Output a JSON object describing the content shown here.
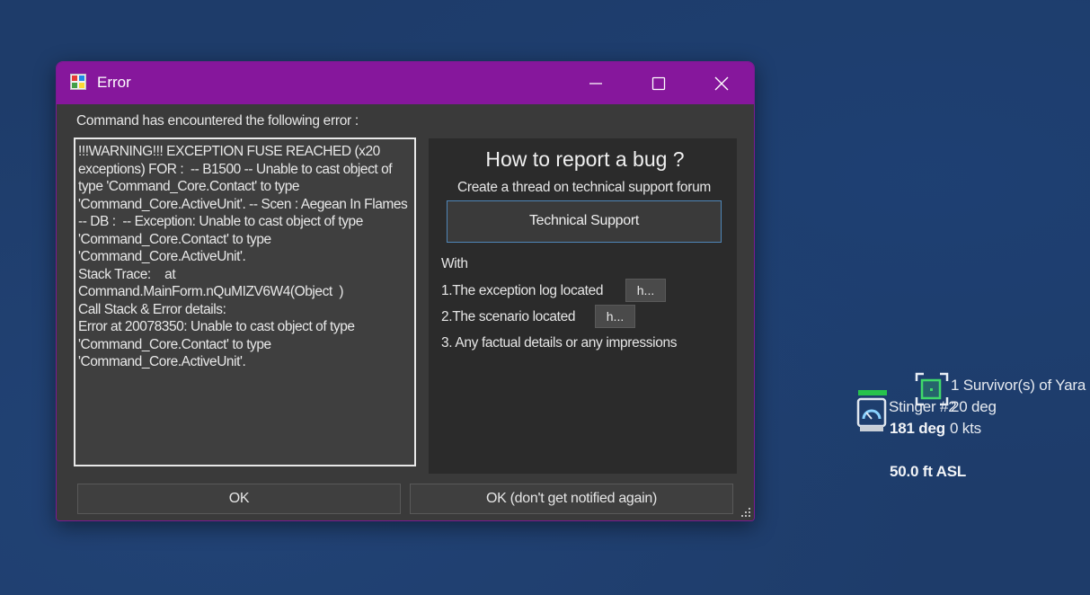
{
  "dialog": {
    "title": "Error",
    "intro": "Command has encountered the following error :",
    "error_text": "!!!WARNING!!! EXCEPTION FUSE REACHED (x20 exceptions) FOR :  -- B1500 -- Unable to cast object of type 'Command_Core.Contact' to type 'Command_Core.ActiveUnit'. -- Scen : Aegean In Flames -- DB :  -- Exception: Unable to cast object of type 'Command_Core.Contact' to type 'Command_Core.ActiveUnit'.\nStack Trace:    at Command.MainForm.nQuMIZV6W4(Object  )\nCall Stack & Error details:\nError at 20078350: Unable to cast object of type 'Command_Core.Contact' to type 'Command_Core.ActiveUnit'.",
    "report": {
      "title": "How to report a bug ?",
      "subtitle": "Create a thread on technical support forum",
      "support_button": "Technical Support",
      "with_label": "With",
      "step1": "1.The exception log located",
      "step1_button": "h...",
      "step2": "2.The scenario located",
      "step2_button": "h...",
      "step3": "3. Any factual details or any impressions"
    },
    "ok_button": "OK",
    "ok_dont_notify_button": "OK (don't get notified again)"
  },
  "map": {
    "unit_name": "Stinger #2",
    "survivor_label": "1 Survivor(s) of Yara",
    "survivor_heading": "20 deg",
    "unit_heading": "181 deg",
    "survivor_speed": "0 kts",
    "altitude": "50.0 ft ASL"
  },
  "colors": {
    "titlebar": "#86179c",
    "map_background": "#1e3c6a",
    "unit_status": "#27c24c",
    "survivor_marker": "#3fd96a"
  },
  "icons": [
    "app-icon",
    "minimize-icon",
    "maximize-icon",
    "close-icon",
    "resize-grip-icon",
    "ship-unit-icon",
    "survivor-marker-icon"
  ]
}
